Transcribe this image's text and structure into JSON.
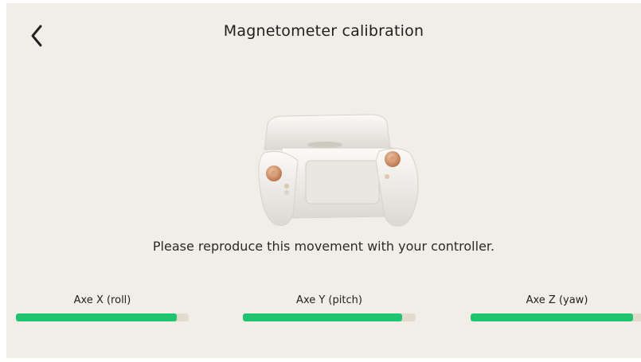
{
  "header": {
    "back_icon": "chevron-left-icon",
    "title": "Magnetometer calibration"
  },
  "illustration": {
    "name": "controller-illustration"
  },
  "instruction": "Please reproduce this movement with your controller.",
  "axes": [
    {
      "label": "Axe X (roll)",
      "progress_percent": 93
    },
    {
      "label": "Axe Y (pitch)",
      "progress_percent": 92
    },
    {
      "label": "Axe Z (yaw)",
      "progress_percent": 94
    }
  ],
  "colors": {
    "background": "#f1eee8",
    "progress_fill": "#1ec46e",
    "progress_track": "#e2dccf",
    "knob_accent": "#c9855a"
  }
}
